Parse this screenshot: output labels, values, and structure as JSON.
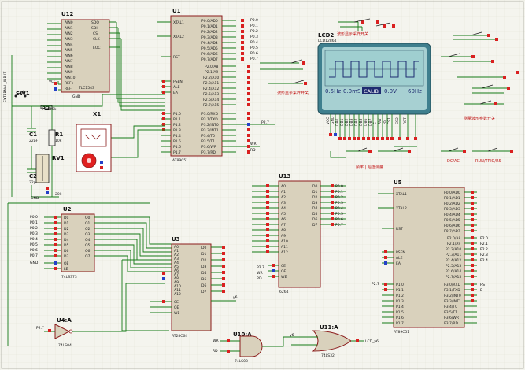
{
  "chips": {
    "u12": {
      "ref": "U12",
      "part": "TLC1543",
      "left": [
        "AIN0",
        "AIN1",
        "AIN2",
        "AIN3",
        "AIN4",
        "AIN5",
        "AIN6",
        "AIN7",
        "AIN8",
        "AIN9",
        "AIN10"
      ],
      "right": [
        "SDO",
        "SDI",
        "CS",
        "CLK",
        "EOC"
      ],
      "bottom": [
        "REF+",
        "REF-"
      ],
      "vcc": "VCC",
      "gnd": "GND"
    },
    "u1": {
      "ref": "U1",
      "part": "AT89C51",
      "left": [
        "XTAL1",
        "XTAL2",
        "RST",
        "PSEN",
        "ALE",
        "EA",
        "P1.0",
        "P1.1",
        "P1.2",
        "P1.3",
        "P1.4",
        "P1.5",
        "P1.6",
        "P1.7"
      ],
      "right": [
        "P0.0/AD0",
        "P0.1/AD1",
        "P0.2/AD2",
        "P0.3/AD3",
        "P0.4/AD4",
        "P0.5/AD5",
        "P0.6/AD6",
        "P0.7/AD7",
        "P2.0/A8",
        "P2.1/A9",
        "P2.2/A10",
        "P2.3/A11",
        "P2.4/A12",
        "P2.5/A13",
        "P2.6/A14",
        "P2.7/A15",
        "P3.0/RXD",
        "P3.1/TXD",
        "P3.2/INT0",
        "P3.3/INT1",
        "P3.4/T0",
        "P3.5/T1",
        "P3.6/WR",
        "P3.7/RD"
      ]
    },
    "u2": {
      "ref": "U2",
      "part": "74LS373",
      "left": [
        "D0",
        "D1",
        "D2",
        "D3",
        "D4",
        "D5",
        "D6",
        "D7",
        "OE",
        "LE"
      ],
      "right": [
        "Q0",
        "Q1",
        "Q2",
        "Q3",
        "Q4",
        "Q5",
        "Q6",
        "Q7"
      ]
    },
    "u3": {
      "ref": "U3",
      "part": "AT28C64",
      "left": [
        "A0",
        "A1",
        "A2",
        "A3",
        "A4",
        "A5",
        "A6",
        "A7",
        "A8",
        "A9",
        "A10",
        "A11",
        "A12",
        "CE",
        "OE",
        "WE"
      ],
      "right": [
        "D0",
        "D1",
        "D2",
        "D3",
        "D4",
        "D5",
        "D6",
        "D7"
      ]
    },
    "u13": {
      "ref": "U13",
      "part": "6264",
      "left": [
        "A0",
        "A1",
        "A2",
        "A3",
        "A4",
        "A5",
        "A6",
        "A7",
        "A8",
        "A9",
        "A10",
        "A11",
        "A12",
        "CE",
        "OE",
        "WE"
      ],
      "right": [
        "D0",
        "D1",
        "D2",
        "D3",
        "D4",
        "D5",
        "D6",
        "D7"
      ]
    },
    "u5": {
      "ref": "U5",
      "part": "AT89C51",
      "left": [
        "XTAL1",
        "XTAL2",
        "RST",
        "PSEN",
        "ALE",
        "EA",
        "P1.0",
        "P1.1",
        "P1.2",
        "P1.3",
        "P1.4",
        "P1.5",
        "P1.6",
        "P1.7"
      ],
      "right": [
        "P0.0/AD0",
        "P0.1/AD1",
        "P0.2/AD2",
        "P0.3/AD3",
        "P0.4/AD4",
        "P0.5/AD5",
        "P0.6/AD6",
        "P0.7/AD7",
        "P2.0/A8",
        "P2.1/A9",
        "P2.2/A10",
        "P2.3/A11",
        "P2.4/A12",
        "P2.5/A13",
        "P2.6/A14",
        "P2.7/A15",
        "P3.0/RXD",
        "P3.1/TXD",
        "P3.2/INT0",
        "P3.3/INT1",
        "P3.4/T0",
        "P3.5/T1",
        "P3.6/WR",
        "P3.7/RD"
      ]
    }
  },
  "gates": {
    "u4a": {
      "ref": "U4:A",
      "part": "74LS04",
      "input": "P2.7"
    },
    "u10a": {
      "ref": "U10:A",
      "part": "74LS08",
      "inputs": [
        "WR",
        "RD"
      ],
      "output": "y6"
    },
    "u11a": {
      "ref": "U11:A",
      "part": "74LS32",
      "output": "LCD_y6"
    }
  },
  "passives": {
    "c1": {
      "ref": "C1",
      "value": "22pF"
    },
    "c2": {
      "ref": "C2",
      "value": "22pF"
    },
    "r1": {
      "ref": "R1",
      "value": "10k"
    },
    "r2": {
      "ref": "R2",
      "value": "10k"
    },
    "rv1": {
      "ref": "RV1",
      "value": "20k"
    },
    "x1": {
      "ref": "X1",
      "value": "CRYSTAL"
    },
    "sw1": {
      "ref": "SW1",
      "value": "SW-SPST"
    }
  },
  "lcd": {
    "ref": "LCD2",
    "part": "LCD12864",
    "readout": [
      "0.5Hz",
      "0.0mS",
      "CALIB",
      "0.0V",
      "60Hz"
    ],
    "pins": [
      "VCC",
      "GND",
      "DB0",
      "DB1",
      "DB2",
      "DB3",
      "DB4",
      "DB5",
      "DB6",
      "DB7",
      "E",
      "RW",
      "RS",
      "CS1",
      "CS2",
      "RST"
    ]
  },
  "labels": {
    "lcd_top_label": "波形显示采样开关",
    "lcd_left_label": "波形显示采样开关",
    "right_block_label": "测量波形参数开关",
    "bottom_mid_label": "频率 | 幅值测量",
    "bottom_right_label_1": "DC/AC",
    "bottom_right_label_2": "RUN/TRIG/RS",
    "vertical_net": "EXTERNAL_INPUT"
  },
  "nets": {
    "bus_names": [
      "P0.0",
      "P0.1",
      "P0.2",
      "P0.3",
      "P0.4",
      "P0.5",
      "P0.6",
      "P0.7"
    ],
    "misc": [
      "P2.7",
      "WR",
      "RD",
      "y6",
      "LCD_y6",
      "RS",
      "E",
      "P2.0",
      "P2.1",
      "P2.2",
      "P2.3",
      "P2.4"
    ]
  }
}
